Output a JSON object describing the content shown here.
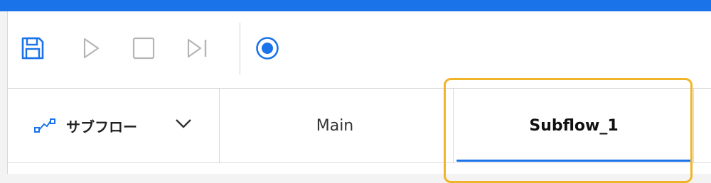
{
  "colors": {
    "accent": "#1a73e8",
    "highlight": "#f0b429"
  },
  "toolbar": {
    "save_icon": "save-icon",
    "run_icon": "play-icon",
    "stop_icon": "stop-icon",
    "step_icon": "step-next-icon",
    "record_icon": "record-icon"
  },
  "subflows": {
    "label": "サブフロー",
    "icon": "subflow-icon",
    "dropdown_icon": "chevron-down-icon"
  },
  "tabs": [
    {
      "label": "Main",
      "active": false
    },
    {
      "label": "Subflow_1",
      "active": true
    }
  ]
}
